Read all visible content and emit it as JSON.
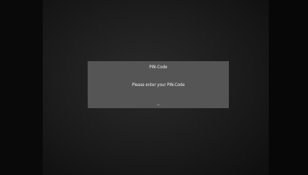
{
  "dialog": {
    "title": "PIN-Code",
    "prompt": "Please enter your PIN-Code",
    "input_value": "_"
  },
  "colors": {
    "background": "#1e1e1e",
    "dialog_background": "#555555",
    "text": "#f4f4f4"
  }
}
